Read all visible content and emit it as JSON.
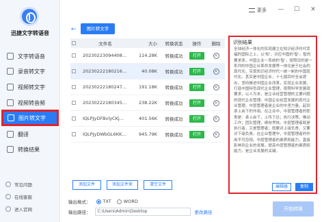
{
  "app": {
    "name": "迅捷文字转语音"
  },
  "sidebar": {
    "items": [
      {
        "label": "文字转语音",
        "icon": "text-to-speech-icon"
      },
      {
        "label": "录音转文字",
        "icon": "record-icon"
      },
      {
        "label": "视频转文字",
        "icon": "video-icon"
      },
      {
        "label": "视频转音频",
        "icon": "video-audio-icon"
      },
      {
        "label": "图片转文字",
        "icon": "image-icon"
      },
      {
        "label": "翻译",
        "icon": "translate-icon"
      },
      {
        "label": "转换结果",
        "icon": "result-icon"
      }
    ],
    "bottom": [
      {
        "label": "常见问题"
      },
      {
        "label": "在线客服"
      },
      {
        "label": "进入官网"
      }
    ]
  },
  "titlebar": {
    "more_label": "更多",
    "minimize": "—",
    "maximize": "☐",
    "close": "✕"
  },
  "tabs": {
    "back": "←",
    "active": "图片转文字"
  },
  "table": {
    "headers": {
      "name": "文件名",
      "size": "大小",
      "status": "转换状态",
      "op": "操作",
      "del": "删除"
    },
    "rows": [
      {
        "name": "20230223094408...",
        "size": "114.28K",
        "status": "转换成功",
        "op": "打开"
      },
      {
        "name": "20230222180216...",
        "size": "40.08K",
        "status": "转换成功",
        "op": "打开"
      },
      {
        "name": "20230222180247...",
        "size": "191.18K",
        "status": "转换成功",
        "op": "打开"
      },
      {
        "name": "20230222180345...",
        "size": "238.22K",
        "status": "转换成功",
        "op": "打开"
      },
      {
        "name": "IQLPJyDFBvlyCKj...",
        "size": "401.56K",
        "status": "转换成功",
        "op": "打开"
      },
      {
        "name": "IQLPJyDWbGL6KK...",
        "size": "945.79K",
        "status": "转换成功",
        "op": "打开"
      }
    ],
    "selected_row": 1
  },
  "actions": {
    "add_file": "添加文件",
    "add_folder": "添加文件夹",
    "clear_list": "清空文件"
  },
  "output": {
    "format_label": "输出格式：",
    "formats": [
      "TXT",
      "WORD"
    ],
    "selected_format": "TXT",
    "path_label": "输出路径：",
    "path_value": "C:\\Users\\Admin\\Desktop",
    "change_path": "更改路径"
  },
  "start_button": "开始转换",
  "result": {
    "title": "识别结果",
    "text": "全球经济一体化的实现建立在知识经济时代幸福的国际之上，以'知'，对应中国的'智'。智的要求来，中国企业一系统的'智'，按照目的是一系列的中国企业革命发展等一体化是于社会的现代化，实现知识经济时代一统一制的中国现代化。其实是中国企业，十七届四中全会提出，坚持推进中国企业改革，实现企业发展，打造中国特色现代企业管理，按照科学发展观要求，以人为本，是企业经营管理的主要问题的现代企业管理。中国企业经营发展的现代企业管理。中层管理者是企业的中坚力量，起到承上启下的作用。在企业中，中层管理者的职责是：承上启下，上传下达；执行决策，推动工作；团队管理，绩效考核。中层管理者既是执行者，又是管理者；既要对上级负责，又要对下级负责。在企业管理中，中层管理者的作用不可忽视。中层管理者的素质和能力，直接影响到企业的发展。提高中层管理者的素质和能力，是企业发展的关键。",
    "edit_label": "编辑器",
    "copy_label": "复制"
  }
}
